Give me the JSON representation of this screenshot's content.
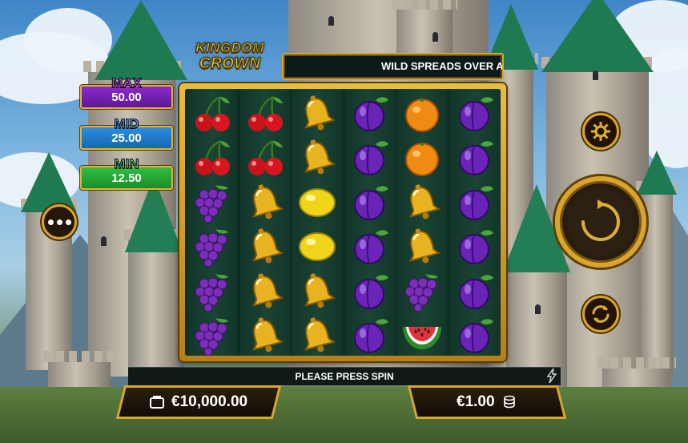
{
  "game": {
    "logo_line1": "KINGDOM",
    "logo_line2": "CROWN"
  },
  "marquee": {
    "text": "WILD SPREADS OVER A"
  },
  "jackpots": [
    {
      "label": "MAX",
      "value": "50.00",
      "color": "#8a2bd0"
    },
    {
      "label": "MID",
      "value": "25.00",
      "color": "#2a8ee0"
    },
    {
      "label": "MIN",
      "value": "12.50",
      "color": "#2fbf3f"
    }
  ],
  "reels": [
    [
      "cherry",
      "cherry",
      "grapes",
      "grapes",
      "grapes",
      "grapes"
    ],
    [
      "cherry",
      "cherry",
      "bell",
      "bell",
      "bell",
      "bell"
    ],
    [
      "bell",
      "bell",
      "lemon",
      "lemon",
      "bell",
      "bell"
    ],
    [
      "plum",
      "plum",
      "plum",
      "plum",
      "plum",
      "plum"
    ],
    [
      "orange",
      "orange",
      "bell",
      "bell",
      "grapes",
      "watermelon"
    ],
    [
      "plum",
      "plum",
      "plum",
      "plum",
      "plum",
      "plum"
    ]
  ],
  "status": {
    "message": "PLEASE PRESS SPIN"
  },
  "balance": {
    "value": "€10,000.00",
    "icon": "wallet-icon"
  },
  "bet": {
    "value": "€1.00",
    "icon": "coins-icon"
  },
  "buttons": {
    "menu": "menu-dots-icon",
    "settings": "gear-icon",
    "spin": "spin-arrow-icon",
    "autoplay": "autoplay-icon"
  }
}
